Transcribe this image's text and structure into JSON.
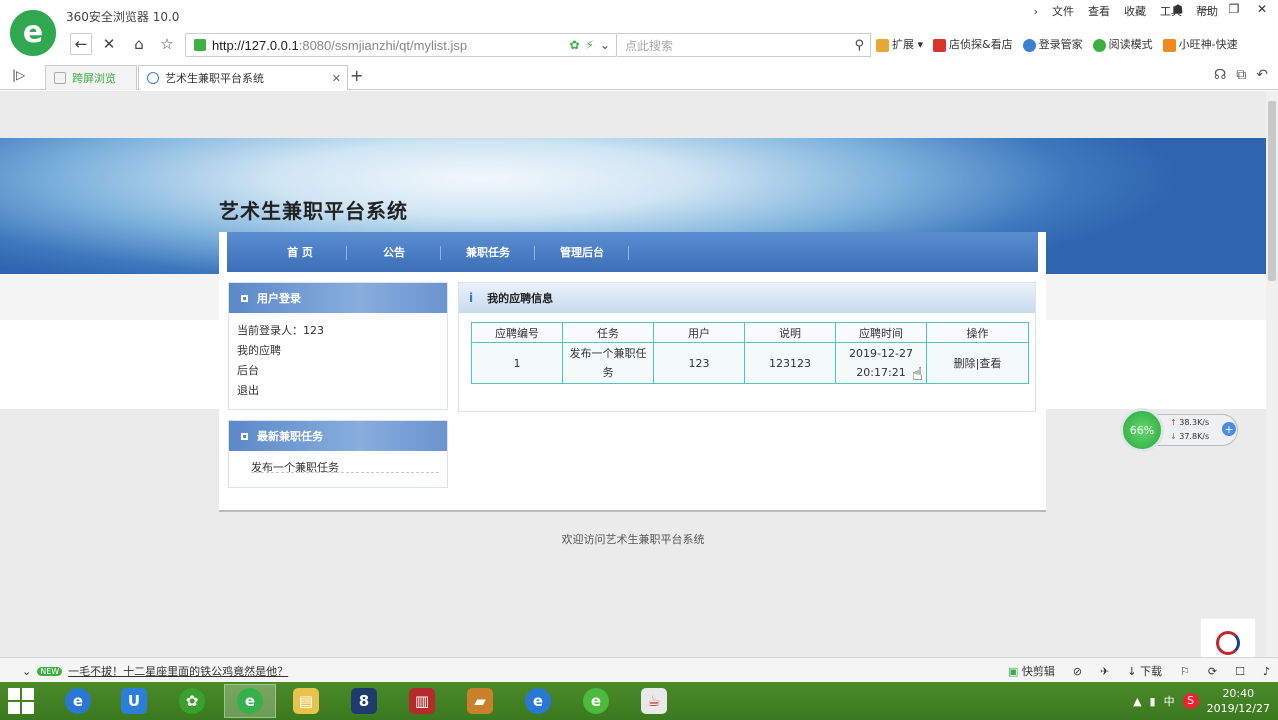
{
  "browser": {
    "app_title": "360安全浏览器 10.0",
    "menu": [
      "文件",
      "查看",
      "收藏",
      "工具",
      "帮助"
    ],
    "url_host": "http://127.0.0.1",
    "url_rest": ":8080/ssmjianzhi/qt/mylist.jsp",
    "search_placeholder": "点此搜索",
    "extensions": [
      "扩展",
      "店侦探&看店",
      "登录管家",
      "阅读模式",
      "小旺神-快速"
    ],
    "tabs": [
      {
        "label": "跨屏浏览"
      },
      {
        "label": "艺术生兼职平台系统"
      }
    ]
  },
  "site": {
    "title": "艺术生兼职平台系统",
    "nav": [
      "首 页",
      "公告",
      "兼职任务",
      "管理后台"
    ],
    "login_panel": {
      "heading": "用户登录",
      "items": [
        "当前登录人：123",
        "我的应聘",
        "后台",
        "退出"
      ]
    },
    "task_panel": {
      "heading": "最新兼职任务",
      "items": [
        "发布一个兼职任务"
      ]
    },
    "content": {
      "heading": "我的应聘信息",
      "columns": [
        "应聘编号",
        "任务",
        "用户",
        "说明",
        "应聘时间",
        "操作"
      ],
      "rows": [
        {
          "id": "1",
          "task": "发布一个兼职任务",
          "user": "123",
          "desc": "123123",
          "time": "2019-12-27 20:17:21",
          "ops": "删除|查看"
        }
      ]
    },
    "footer": "欢迎访问艺术生兼职平台系统"
  },
  "widget": {
    "percent": "66%",
    "up": "38.3K/s",
    "down": "37.8K/s"
  },
  "statusbar": {
    "news_badge": "NEW",
    "news": "一毛不拔！十二星座里面的铁公鸡竟然是他？",
    "right": [
      "快剪辑",
      "下载"
    ]
  },
  "taskbar": {
    "time": "20:40",
    "date": "2019/12/27",
    "ime": "中"
  }
}
